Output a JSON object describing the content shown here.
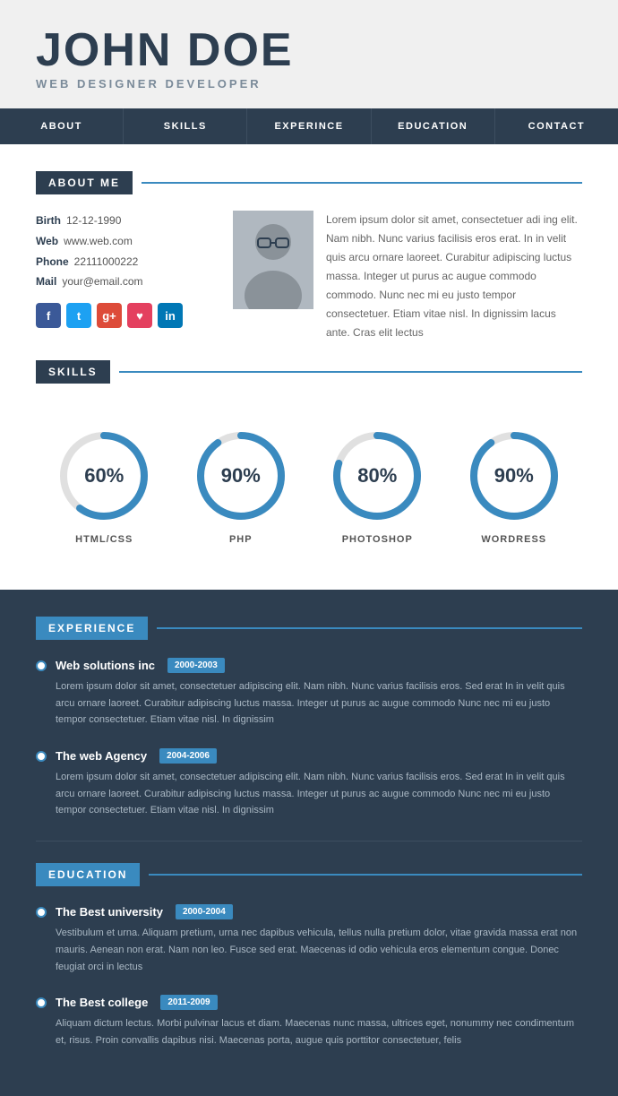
{
  "header": {
    "name": "JOHN DOE",
    "title": "WEB DESIGNER DEVELOPER"
  },
  "nav": {
    "items": [
      "ABOUT",
      "SKILLS",
      "EXPERINCE",
      "EDUCATION",
      "CONTACT"
    ]
  },
  "about": {
    "section_label": "ABOUT ME",
    "birth_label": "Birth",
    "birth_value": "12-12-1990",
    "web_label": "Web",
    "web_value": "www.web.com",
    "phone_label": "Phone",
    "phone_value": "22111000222",
    "mail_label": "Mail",
    "mail_value": "your@email.com",
    "bio": "Lorem ipsum dolor sit amet, consectetuer adi ing elit. Nam nibh. Nunc varius facilisis eros erat. In in velit quis arcu ornare laoreet. Curabitur adipiscing luctus massa. Integer ut purus ac augue commodo commodo. Nunc nec mi eu justo tempor consectetuer. Etiam vitae nisl. In dignissim lacus ante. Cras elit lectus"
  },
  "skills": {
    "section_label": "SKILLS",
    "items": [
      {
        "label": "HTML/CSS",
        "percent": 60,
        "circumference": 283,
        "offset": 113
      },
      {
        "label": "PHP",
        "percent": 90,
        "circumference": 283,
        "offset": 28
      },
      {
        "label": "PHOTOSHOP",
        "percent": 80,
        "circumference": 283,
        "offset": 57
      },
      {
        "label": "WORDRESS",
        "percent": 90,
        "circumference": 283,
        "offset": 28
      }
    ]
  },
  "experience": {
    "section_label": "EXPERIENCE",
    "items": [
      {
        "company": "Web solutions inc",
        "years": "2000-2003",
        "desc": "Lorem ipsum dolor sit amet, consectetuer adipiscing elit. Nam nibh. Nunc varius facilisis eros. Sed erat In in velit quis arcu ornare laoreet. Curabitur adipiscing luctus massa. Integer ut purus ac augue commodo Nunc nec mi eu justo tempor consectetuer. Etiam vitae nisl. In dignissim"
      },
      {
        "company": "The web Agency",
        "years": "2004-2006",
        "desc": "Lorem ipsum dolor sit amet, consectetuer adipiscing elit. Nam nibh. Nunc varius facilisis eros. Sed erat In in velit quis arcu ornare laoreet. Curabitur adipiscing luctus massa. Integer ut purus ac augue commodo Nunc nec mi eu justo tempor consectetuer. Etiam vitae nisl. In dignissim"
      }
    ]
  },
  "education": {
    "section_label": "EDUCATION",
    "items": [
      {
        "school": "The Best university",
        "years": "2000-2004",
        "desc": "Vestibulum et urna. Aliquam pretium, urna nec dapibus vehicula, tellus nulla pretium dolor, vitae gravida massa erat non mauris. Aenean non erat. Nam non leo. Fusce sed erat. Maecenas id odio vehicula eros elementum congue. Donec feugiat orci in lectus"
      },
      {
        "school": "The Best college",
        "years": "2011-2009",
        "desc": "Aliquam dictum lectus. Morbi pulvinar lacus et diam. Maecenas nunc massa, ultrices eget, nonummy nec condimentum et, risus. Proin convallis dapibus nisi. Maecenas porta, augue quis porttitor consectetuer, felis"
      }
    ]
  }
}
